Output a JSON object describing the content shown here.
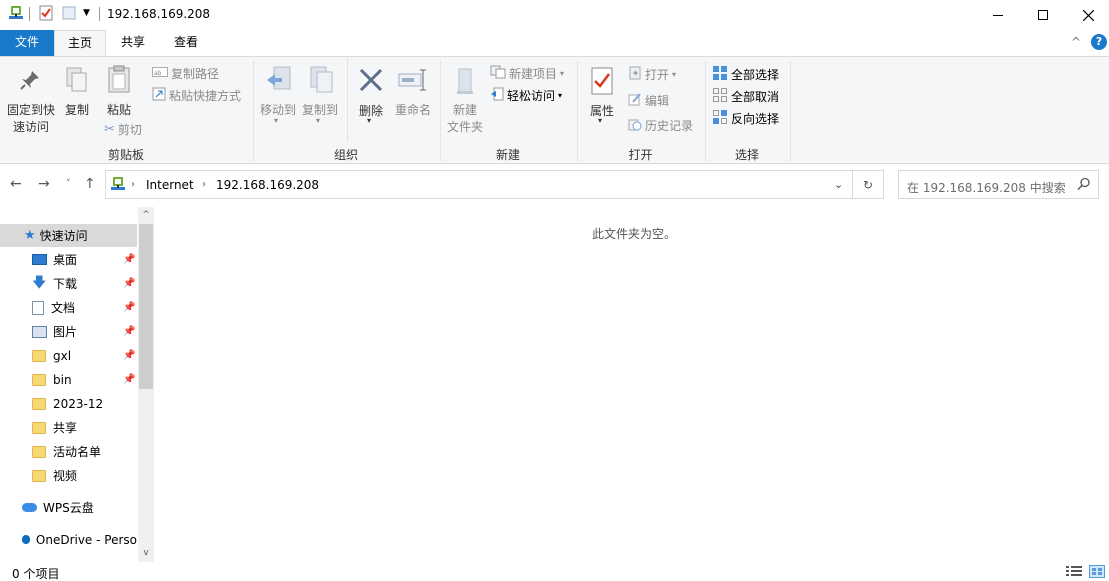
{
  "window": {
    "title": "192.168.169.208",
    "controls": {
      "minimize": "—",
      "maximize": "☐",
      "close": "✕"
    }
  },
  "tabs": {
    "file": "文件",
    "home": "主页",
    "share": "共享",
    "view": "查看"
  },
  "ribbon": {
    "clipboard": {
      "pin_line1": "固定到快",
      "pin_line2": "速访问",
      "copy": "复制",
      "paste": "粘贴",
      "copy_path": "复制路径",
      "paste_shortcut": "粘贴快捷方式",
      "cut": "剪切",
      "label": "剪贴板"
    },
    "organize": {
      "move_to": "移动到",
      "copy_to": "复制到",
      "delete": "删除",
      "rename": "重命名",
      "label": "组织"
    },
    "new": {
      "new_folder_line1": "新建",
      "new_folder_line2": "文件夹",
      "new_item": "新建项目",
      "easy_access": "轻松访问",
      "label": "新建"
    },
    "open": {
      "properties": "属性",
      "open": "打开",
      "edit": "编辑",
      "history": "历史记录",
      "label": "打开"
    },
    "select": {
      "select_all": "全部选择",
      "select_none": "全部取消",
      "invert": "反向选择",
      "label": "选择"
    }
  },
  "address": {
    "crumbs": [
      "Internet",
      "192.168.169.208"
    ],
    "search_placeholder": "在 192.168.169.208 中搜索"
  },
  "nav": {
    "quick_access": "快速访问",
    "items": [
      {
        "label": "桌面",
        "pinned": true
      },
      {
        "label": "下载",
        "pinned": true
      },
      {
        "label": "文档",
        "pinned": true
      },
      {
        "label": "图片",
        "pinned": true
      },
      {
        "label": "gxl",
        "pinned": true
      },
      {
        "label": "bin",
        "pinned": true
      },
      {
        "label": "2023-12",
        "pinned": false
      },
      {
        "label": "共享",
        "pinned": false
      },
      {
        "label": "活动名单",
        "pinned": false
      },
      {
        "label": "视频",
        "pinned": false
      }
    ],
    "wps": "WPS云盘",
    "onedrive": "OneDrive - Perso"
  },
  "content": {
    "empty": "此文件夹为空。"
  },
  "status": {
    "count": "0 个项目"
  },
  "colors": {
    "accent": "#1979ca",
    "selected": "#cce8ff",
    "folder": "#f8d775"
  }
}
